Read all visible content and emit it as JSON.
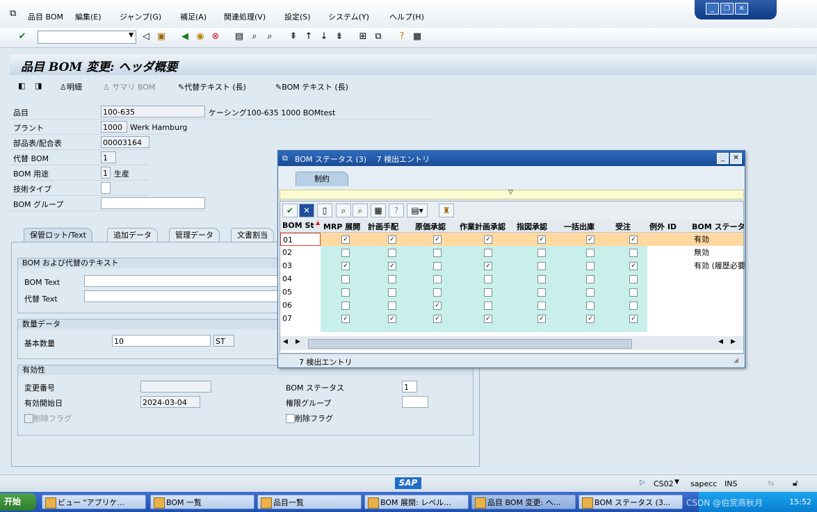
{
  "menu": {
    "items": [
      "品目 BOM",
      "編集(E)",
      "ジャンプ(G)",
      "補足(A)",
      "関連処理(V)",
      "設定(S)",
      "システム(Y)",
      "ヘルプ(H)"
    ]
  },
  "title": "品目 BOM 変更: ヘッダ概要",
  "app_toolbar": {
    "detail": "明細",
    "summary": "サマリ BOM",
    "alt_text": "代替テキスト (長)",
    "bom_text": "BOM テキスト (長)"
  },
  "header": {
    "material_label": "品目",
    "material_value": "100-635",
    "material_desc": "ケーシング100-635 1000 BOMtest",
    "plant_label": "プラント",
    "plant_value": "1000",
    "plant_desc": "Werk Hamburg",
    "bom_label": "部品表/配合表",
    "bom_value": "00003164",
    "alt_label": "代替 BOM",
    "alt_value": "1",
    "usage_label": "BOM 用途",
    "usage_value": "1",
    "usage_desc": "生産",
    "tech_type_label": "技術タイプ",
    "tech_type_value": "",
    "bom_group_label": "BOM グループ",
    "bom_group_value": ""
  },
  "tabs": [
    "保管ロット/Text",
    "追加データ",
    "管理データ",
    "文書割当"
  ],
  "tab_content": {
    "group1_title": "BOM および代替のテキスト",
    "bom_text_label": "BOM Text",
    "alt_text_label": "代替 Text",
    "group2_title": "数量データ",
    "base_qty_label": "基本数量",
    "base_qty_value": "10",
    "unit_value": "ST",
    "group3_title": "有効性",
    "change_no_label": "変更番号",
    "change_no_value": "",
    "valid_from_label": "有効開始日",
    "valid_from_value": "2024-03-04",
    "delete_flag_label": "削除フラグ",
    "bom_status_label": "BOM ステータス",
    "bom_status_value": "1",
    "auth_group_label": "権限グループ",
    "auth_group_value": "",
    "delete_flag2_label": "削除フラグ"
  },
  "dialog": {
    "title": "BOM ステータス (3)　 7 検出エントリ",
    "tab": "制約",
    "columns": [
      "BOM St",
      "MRP 展開",
      "計画手配",
      "原価承認",
      "作業計画承認",
      "指図承認",
      "一括出庫",
      "受注",
      "例外 ID",
      "BOM ステータ"
    ],
    "rows": [
      {
        "key": "01",
        "checks": [
          true,
          true,
          true,
          true,
          true,
          true,
          true
        ],
        "status": "有効"
      },
      {
        "key": "02",
        "checks": [
          false,
          false,
          false,
          false,
          false,
          false,
          false
        ],
        "status": "無効"
      },
      {
        "key": "03",
        "checks": [
          true,
          true,
          false,
          true,
          false,
          false,
          true
        ],
        "status": "有効 (履歴必要"
      },
      {
        "key": "04",
        "checks": [
          false,
          false,
          false,
          false,
          false,
          false,
          false
        ],
        "status": ""
      },
      {
        "key": "05",
        "checks": [
          false,
          false,
          false,
          false,
          false,
          false,
          false
        ],
        "status": ""
      },
      {
        "key": "06",
        "checks": [
          false,
          false,
          true,
          false,
          false,
          false,
          false
        ],
        "status": ""
      },
      {
        "key": "07",
        "checks": [
          true,
          true,
          true,
          true,
          true,
          true,
          true
        ],
        "status": ""
      }
    ],
    "footer": "7 検出エントリ"
  },
  "status_bar": {
    "sap_logo": "SAP",
    "tcode": "CS02",
    "server": "sapecc",
    "mode": "INS"
  },
  "taskbar": {
    "start": "开始",
    "tasks": [
      "ビュー \"アプリケ...",
      "BOM 一覧",
      "品目一覧",
      "BOM 展開: レベル...",
      "品目 BOM 変更: ヘ...",
      "BOM ステータス (3..."
    ],
    "watermark": "CSDN @伯赏燕秋月",
    "clock": "15:52"
  },
  "colors": {
    "selected_row": "#ffd9a0",
    "checkbox_area": "#c8efe9",
    "title_blue": "#1a4c96"
  }
}
